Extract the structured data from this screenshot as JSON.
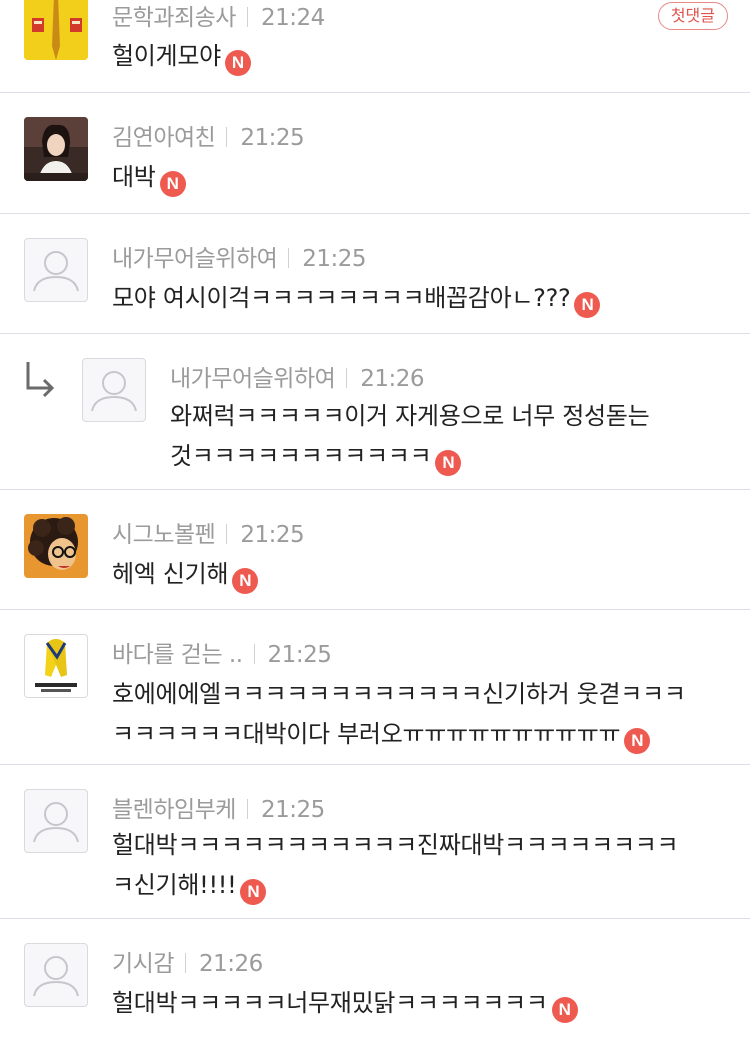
{
  "first_comment_badge": "첫댓글",
  "new_badge": "N",
  "comments": [
    {
      "author": "문학과죄송사",
      "time": "21:24",
      "text": "헐이게모야"
    },
    {
      "author": "김연아여친",
      "time": "21:25",
      "text": "대박"
    },
    {
      "author": "내가무어슬위하여",
      "time": "21:25",
      "text": "모야 여시이걱ㅋㅋㅋㅋㅋㅋㅋㅋ배꼽감아ㄴ???"
    },
    {
      "author": "내가무어슬위하여",
      "time": "21:26",
      "text_line1": "와쩌럭ㅋㅋㅋㅋㅋ이거 자게용으로 너무 정성돋는",
      "text_line2": "것ㅋㅋㅋㅋㅋㅋㅋㅋㅋㅋㅋ",
      "is_reply": true
    },
    {
      "author": "시그노볼펜",
      "time": "21:25",
      "text": "헤엑 신기해"
    },
    {
      "author": "바다를 걷는 ..",
      "time": "21:25",
      "text_line1": "호에에에엘ㅋㅋㅋㅋㅋㅋㅋㅋㅋㅋㅋㅋ신기하거 웃겯ㅋㅋㅋ",
      "text_line2": "ㅋㅋㅋㅋㅋㅋ대박이다 부러오ㅠㅠㅠㅠㅠㅠㅠㅠㅠㅠ"
    },
    {
      "author": "블렌하임부케",
      "time": "21:25",
      "text_line1": "헐대박ㅋㅋㅋㅋㅋㅋㅋㅋㅋㅋㅋ진짜대박ㅋㅋㅋㅋㅋㅋㅋㅋ",
      "text_line2": "ㅋ신기해!!!!"
    },
    {
      "author": "기시감",
      "time": "21:26",
      "text": "헐대박ㅋㅋㅋㅋㅋ너무재밌닭ㅋㅋㅋㅋㅋㅋㅋ"
    }
  ],
  "colors": {
    "new_badge": "#ee5a4f",
    "meta": "#9b9b9b",
    "divider": "#dedee6"
  }
}
